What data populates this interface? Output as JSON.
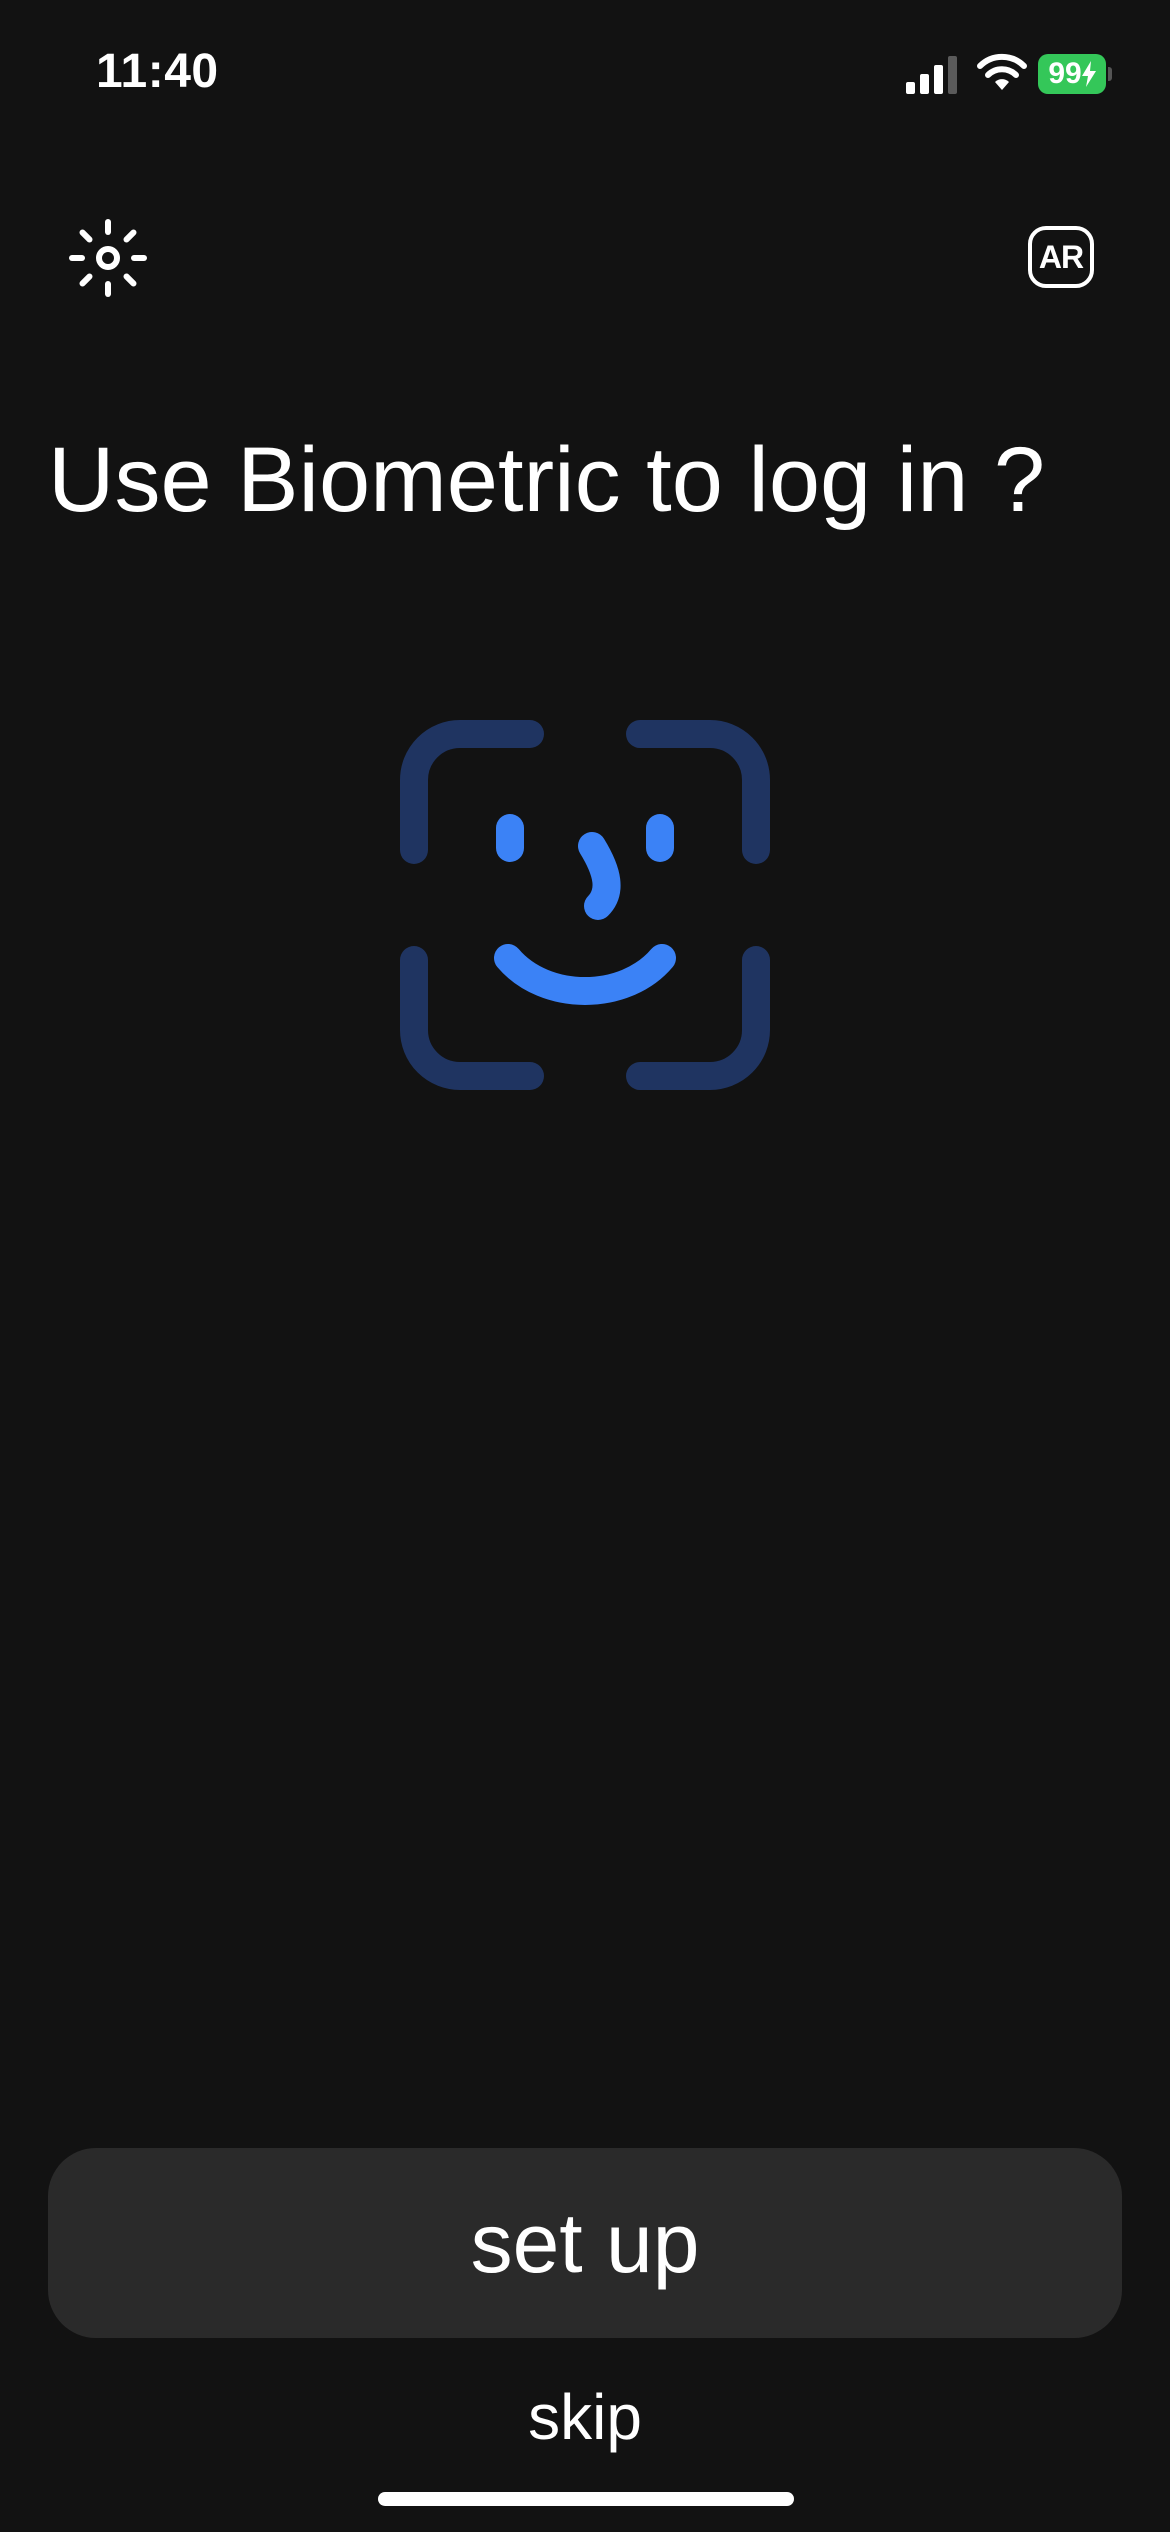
{
  "status_bar": {
    "time": "11:40",
    "battery_level": "99",
    "battery_color": "#34c759",
    "signal_icon": "cellular-signal-icon",
    "wifi_icon": "wifi-icon",
    "charging_icon": "bolt-icon"
  },
  "header": {
    "brightness_icon": "sun-icon",
    "language_label": "AR"
  },
  "main": {
    "title": "Use Biometric to log in ?",
    "illustration_icon": "face-id-icon",
    "accent_color": "#3b82f6",
    "frame_color": "#1f3461"
  },
  "actions": {
    "setup_label": "set up",
    "skip_label": "skip"
  }
}
